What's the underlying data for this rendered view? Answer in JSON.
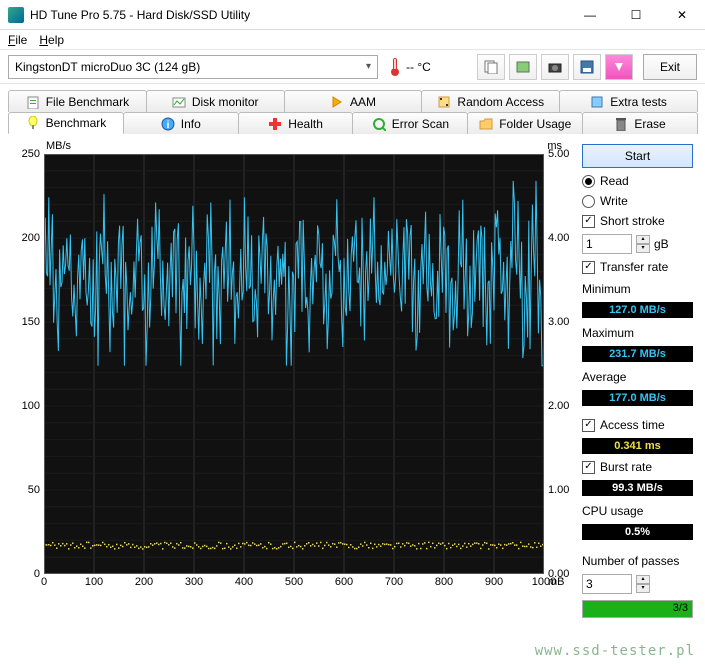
{
  "window": {
    "title": "HD Tune Pro 5.75 - Hard Disk/SSD Utility"
  },
  "menu": {
    "file": "File",
    "help": "Help"
  },
  "toolbar": {
    "drive": "KingstonDT microDuo 3C (124 gB)",
    "temp_value": "-- °C",
    "exit": "Exit"
  },
  "tabs_row1": [
    {
      "label": "File Benchmark",
      "icon": "file-bench"
    },
    {
      "label": "Disk monitor",
      "icon": "disk-mon"
    },
    {
      "label": "AAM",
      "icon": "aam"
    },
    {
      "label": "Random Access",
      "icon": "random"
    },
    {
      "label": "Extra tests",
      "icon": "extra"
    }
  ],
  "tabs_row2": [
    {
      "label": "Benchmark",
      "icon": "bench",
      "active": true
    },
    {
      "label": "Info",
      "icon": "info"
    },
    {
      "label": "Health",
      "icon": "health"
    },
    {
      "label": "Error Scan",
      "icon": "error"
    },
    {
      "label": "Folder Usage",
      "icon": "folder"
    },
    {
      "label": "Erase",
      "icon": "erase"
    }
  ],
  "sidebar": {
    "start": "Start",
    "read": "Read",
    "write": "Write",
    "short_stroke": "Short stroke",
    "short_stroke_val": "1",
    "short_stroke_unit": "gB",
    "transfer_rate": "Transfer rate",
    "minimum": "Minimum",
    "minimum_val": "127.0 MB/s",
    "maximum": "Maximum",
    "maximum_val": "231.7 MB/s",
    "average": "Average",
    "average_val": "177.0 MB/s",
    "access_time": "Access time",
    "access_time_val": "0.341 ms",
    "burst_rate": "Burst rate",
    "burst_rate_val": "99.3 MB/s",
    "cpu_usage": "CPU usage",
    "cpu_usage_val": "0.5%",
    "passes": "Number of passes",
    "passes_val": "3",
    "progress_txt": "3/3"
  },
  "chart_data": {
    "type": "line",
    "left_unit": "MB/s",
    "right_unit": "ms",
    "x_unit": "mB",
    "y_left_ticks": [
      0,
      50,
      100,
      150,
      200,
      250
    ],
    "y_right_ticks": [
      0.0,
      1.0,
      2.0,
      3.0,
      4.0,
      5.0
    ],
    "x_ticks": [
      0,
      100,
      200,
      300,
      400,
      500,
      600,
      700,
      800,
      900,
      1000
    ],
    "transfer_rate_range_low": 127,
    "transfer_rate_range_high": 232,
    "transfer_rate_avg": 177,
    "access_time_avg": 0.341
  },
  "watermark": "www.ssd-tester.pl"
}
